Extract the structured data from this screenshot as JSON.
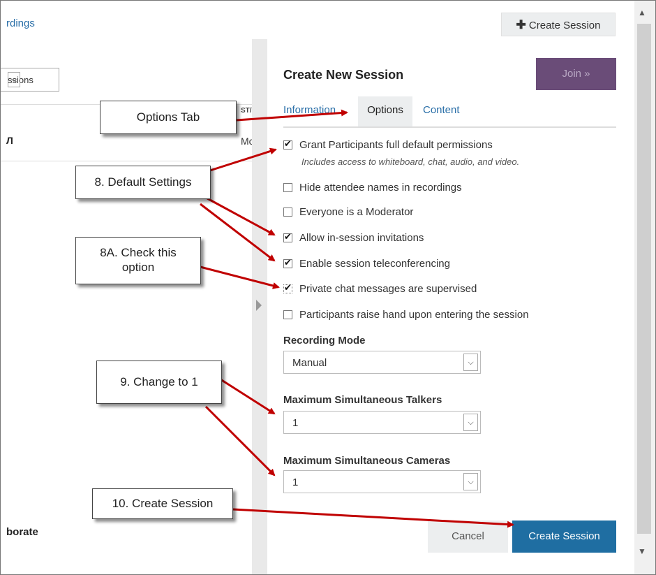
{
  "background": {
    "link_text": "rdings",
    "filter_text": "ssions",
    "col_header": "ST/",
    "row_left": "Л",
    "row_right": "Mo",
    "bottom_text": "borate",
    "create_session_label": "Create Session",
    "plus_icon": "✚"
  },
  "panel": {
    "title": "Create New Session",
    "join_label": "Join »",
    "tabs": [
      "Information",
      "Options",
      "Content"
    ],
    "options": [
      {
        "label": "Grant Participants full default permissions",
        "checked": true
      },
      {
        "label": "Hide attendee names in recordings",
        "checked": false
      },
      {
        "label": "Everyone is a Moderator",
        "checked": false
      },
      {
        "label": "Allow in-session invitations",
        "checked": true
      },
      {
        "label": "Enable session teleconferencing",
        "checked": true
      },
      {
        "label": "Private chat messages are supervised",
        "checked": true
      },
      {
        "label": "Participants raise hand upon entering the session",
        "checked": false
      }
    ],
    "note": "Includes access to whiteboard, chat, audio, and video.",
    "recording_mode_label": "Recording Mode",
    "recording_mode_value": "Manual",
    "talkers_label": "Maximum Simultaneous Talkers",
    "talkers_value": "1",
    "cameras_label": "Maximum Simultaneous Cameras",
    "cameras_value": "1",
    "cancel_label": "Cancel",
    "create_label": "Create Session"
  },
  "callouts": {
    "options_tab": "Options Tab",
    "default_settings": "8. Default Settings",
    "check_option_line1": "8A. Check this",
    "check_option_line2": "option",
    "change_to_1": "9. Change to 1",
    "create_session": "10. Create Session"
  },
  "colors": {
    "accent": "#1f6ea2",
    "join": "#6a4c78",
    "arrow": "#c00000"
  }
}
